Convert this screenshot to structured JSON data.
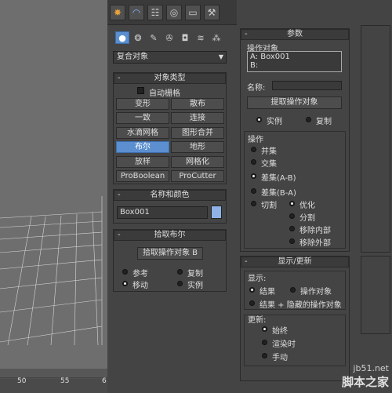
{
  "tabs": {
    "create_icon": "create-icon",
    "modify_icon": "modify-icon",
    "hierarchy_icon": "hierarchy-icon",
    "motion_icon": "motion-icon",
    "display_icon": "display-icon",
    "utilities_icon": "utilities-icon"
  },
  "category_dropdown": "复合对象",
  "object_type": {
    "title": "对象类型",
    "autogrid": "自动栅格",
    "buttons": [
      "变形",
      "散布",
      "一致",
      "连接",
      "水滴网格",
      "图形合并",
      "布尔",
      "地形",
      "放样",
      "网格化",
      "ProBoolean",
      "ProCutter"
    ],
    "active": "布尔"
  },
  "name_color": {
    "title": "名称和颜色",
    "name": "Box001",
    "color": "#8fb3e8"
  },
  "pick_boolean": {
    "title": "拾取布尔",
    "button": "拾取操作对象 B",
    "options": [
      "参考",
      "复制",
      "移动",
      "实例"
    ],
    "selected": "移动"
  },
  "params": {
    "title": "参数",
    "operands_label": "操作对象",
    "operand_a": "A: Box001",
    "operand_b": "B:",
    "name_label": "名称:",
    "extract_button": "提取操作对象",
    "instance": "实例",
    "copy": "复制",
    "operation_label": "操作",
    "ops": [
      "并集",
      "交集",
      "差集(A-B)",
      "差集(B-A)",
      "切割"
    ],
    "selected_op": "差集(A-B)",
    "cut_options": [
      "优化",
      "分割",
      "移除内部",
      "移除外部"
    ],
    "selected_cut": "优化"
  },
  "display_update": {
    "title": "显示/更新",
    "display_label": "显示:",
    "result": "结果",
    "operands": "操作对象",
    "result_hidden": "结果 + 隐藏的操作对象",
    "update_label": "更新:",
    "always": "始终",
    "when_render": "渲染时",
    "manual": "手动"
  },
  "timeline": [
    "50",
    "55",
    "6"
  ],
  "watermark": {
    "line1": "jb51.net",
    "line2": "脚本之家"
  }
}
